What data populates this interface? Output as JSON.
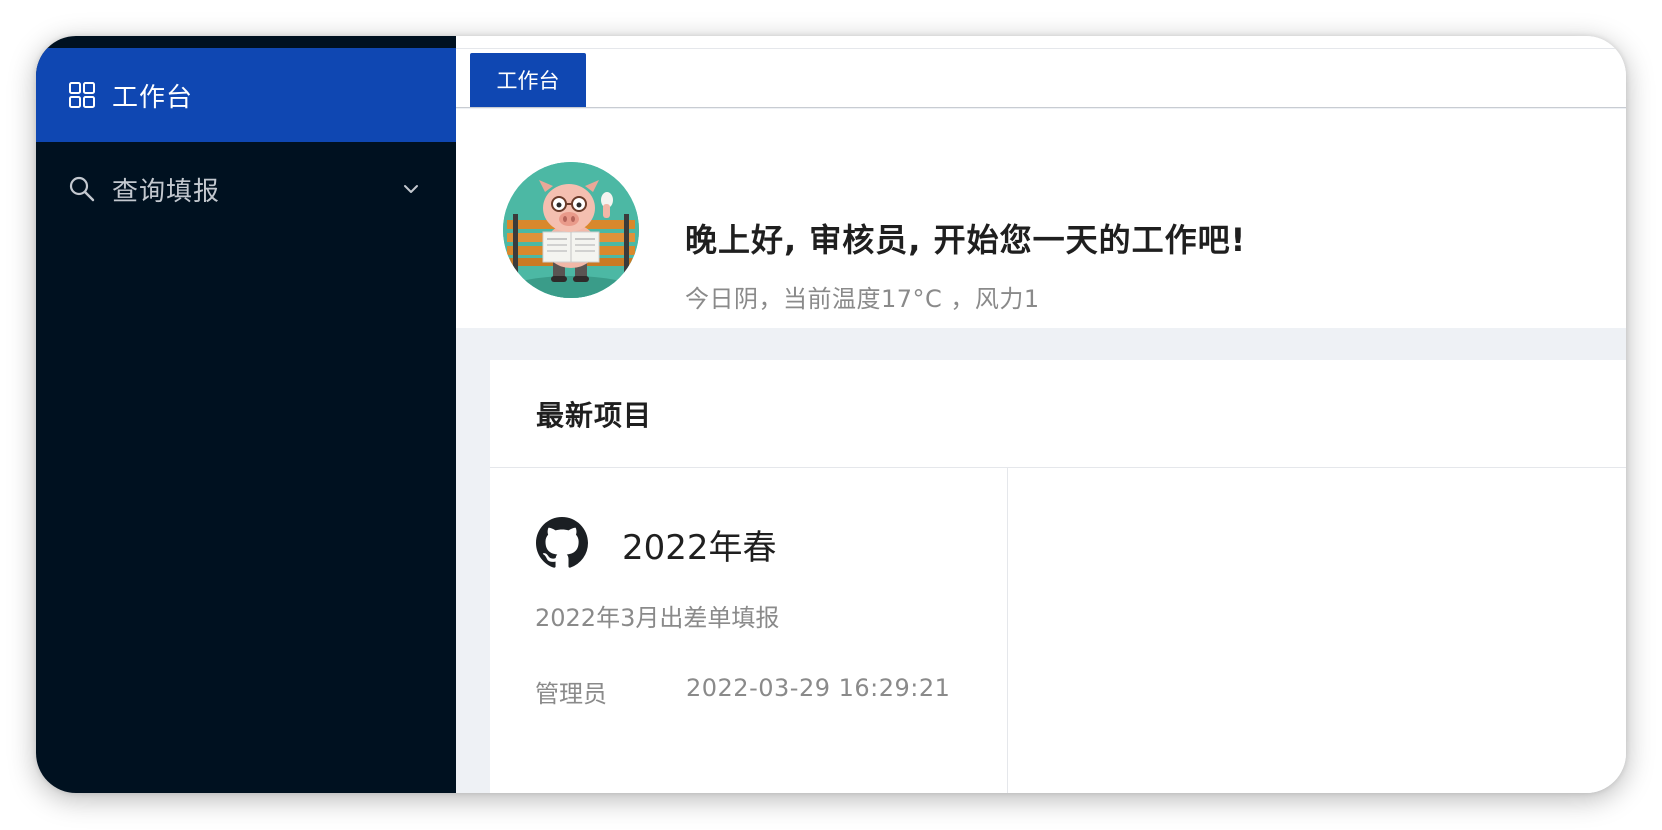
{
  "sidebar": {
    "items": [
      {
        "label": "工作台",
        "icon": "grid-icon",
        "active": true
      },
      {
        "label": "查询填报",
        "icon": "search-icon",
        "expandable": true
      }
    ]
  },
  "tabs": [
    {
      "label": "工作台",
      "active": true
    }
  ],
  "welcome": {
    "greeting": "晚上好, 审核员, 开始您一天的工作吧!",
    "weather": "今日阴，当前温度17°C ，风力1",
    "avatar": "pig-reading-newspaper-avatar"
  },
  "projects": {
    "title": "最新项目",
    "items": [
      {
        "icon": "github-icon",
        "name": "2022年春",
        "description": "2022年3月出差单填报",
        "owner": "管理员",
        "time": "2022-03-29 16:29:21"
      }
    ]
  },
  "colors": {
    "sidebar_bg": "#001120",
    "accent": "#0f47b2",
    "content_bg": "#eef1f5",
    "avatar_bg": "#4cb8a4"
  }
}
